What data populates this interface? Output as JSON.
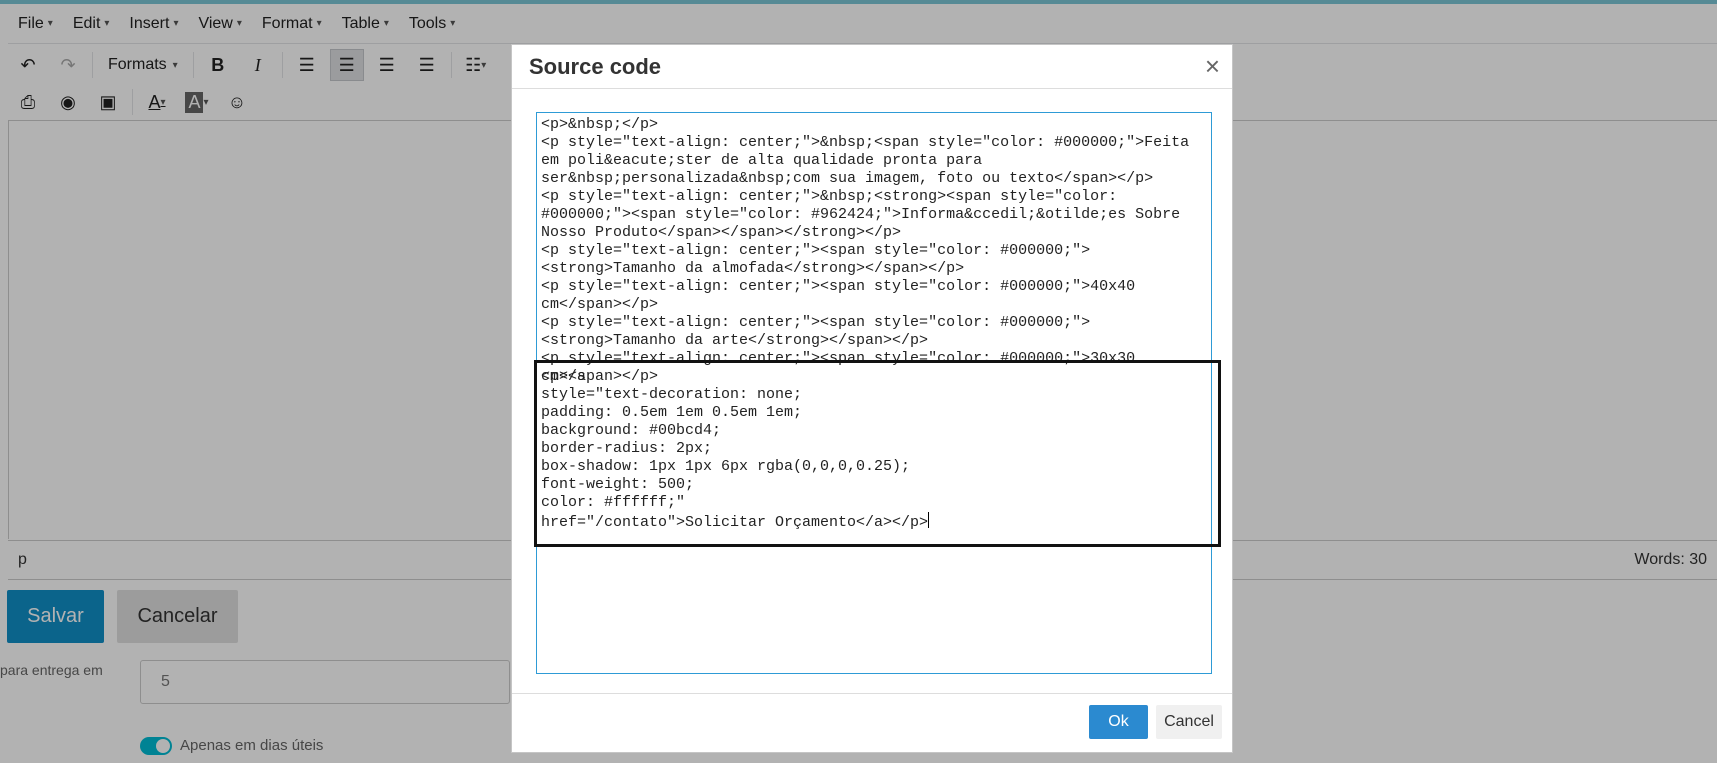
{
  "menubar": {
    "items": [
      {
        "label": "File"
      },
      {
        "label": "Edit"
      },
      {
        "label": "Insert"
      },
      {
        "label": "View"
      },
      {
        "label": "Format"
      },
      {
        "label": "Table"
      },
      {
        "label": "Tools"
      }
    ]
  },
  "toolbar": {
    "formats_label": "Formats",
    "bold_glyph": "B",
    "italic_glyph": "I",
    "text_color_glyph": "A",
    "bg_color_glyph": "A"
  },
  "statusbar": {
    "path": "p",
    "word_count": "Words: 30"
  },
  "form": {
    "save_label": "Salvar",
    "cancel_label": "Cancelar",
    "delivery_label": "para entrega em",
    "delivery_value": "5",
    "business_days_label": "Apenas em dias úteis"
  },
  "dialog": {
    "title": "Source code",
    "close_glyph": "×",
    "code_part1": "<p>&nbsp;</p>\n<p style=\"text-align: center;\">&nbsp;<span style=\"color: #000000;\">Feita em poli&eacute;ster de alta qualidade pronta para ser&nbsp;personalizada&nbsp;com sua imagem, foto ou texto</span></p>\n<p style=\"text-align: center;\">&nbsp;<strong><span style=\"color: #000000;\"><span style=\"color: #962424;\">Informa&ccedil;&otilde;es Sobre Nosso Produto</span></span></strong></p>\n<p style=\"text-align: center;\"><span style=\"color: #000000;\"><strong>Tamanho da almofada</strong></span></p>\n<p style=\"text-align: center;\"><span style=\"color: #000000;\">40x40 cm</span></p>\n<p style=\"text-align: center;\"><span style=\"color: #000000;\"><strong>Tamanho da arte</strong></span></p>\n<p style=\"text-align: center;\"><span style=\"color: #000000;\">30x30 cm</span></p>",
    "code_part2": "<p><a\nstyle=\"text-decoration: none;\npadding: 0.5em 1em 0.5em 1em;\nbackground: #00bcd4;\nborder-radius: 2px;\nbox-shadow: 1px 1px 6px rgba(0,0,0,0.25);\nfont-weight: 500;\ncolor: #ffffff;\"\nhref=\"/contato\">Solicitar Orçamento</a></p>",
    "ok_label": "Ok",
    "cancel_label": "Cancel"
  },
  "colors": {
    "accent": "#1190c8",
    "ok_button": "#2b8ad0",
    "toggle": "#00bcd4"
  }
}
